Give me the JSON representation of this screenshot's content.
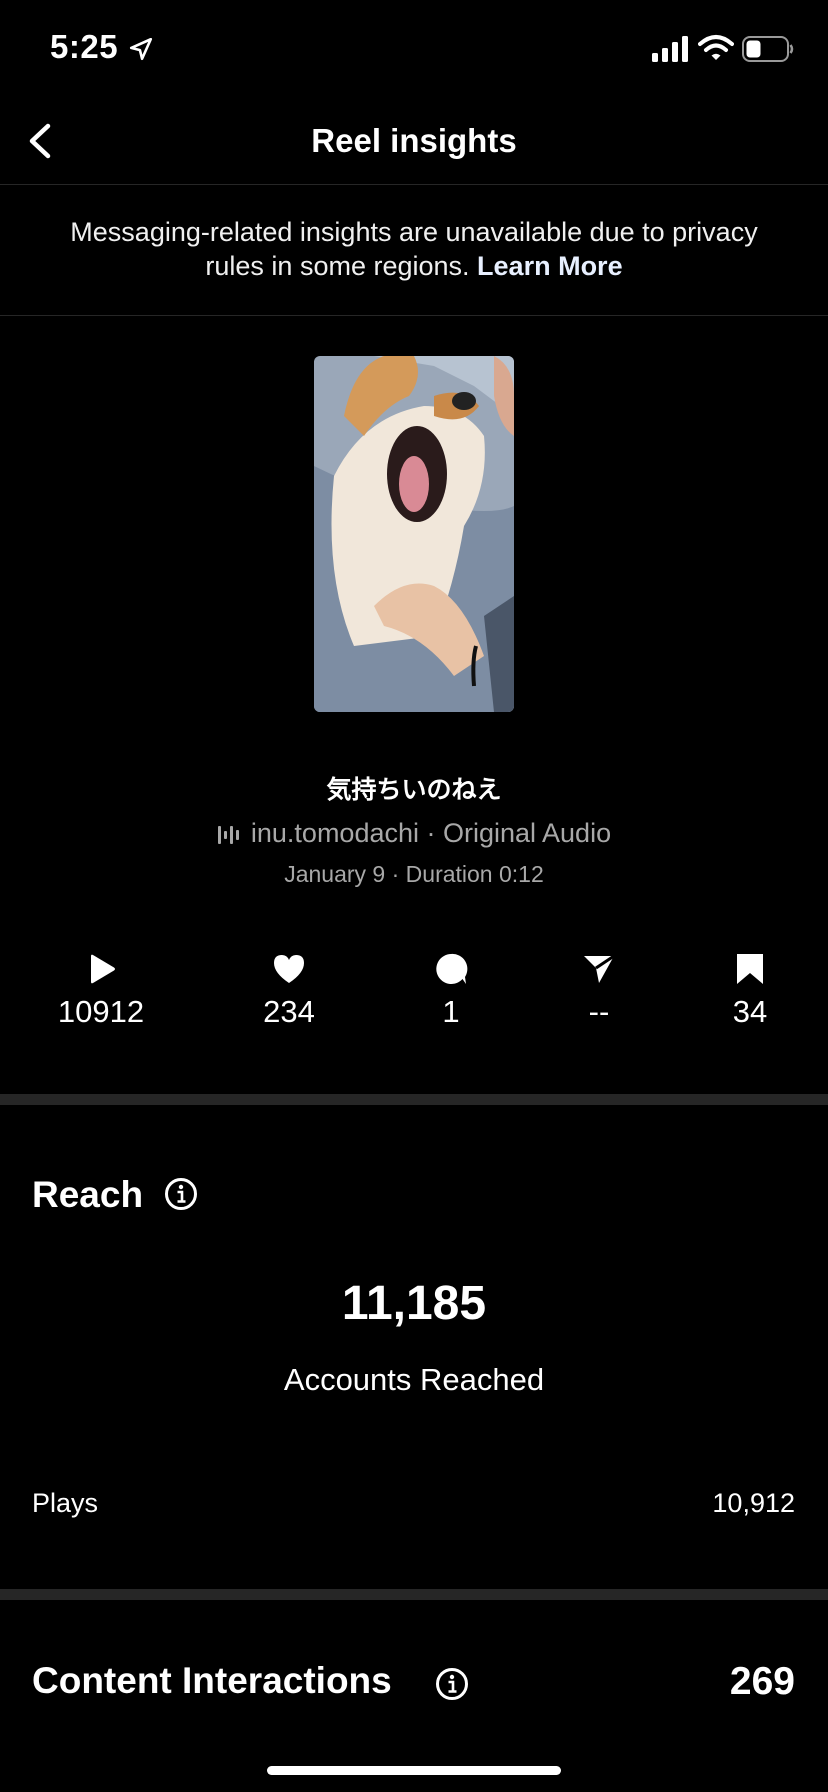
{
  "status_bar": {
    "time": "5:25",
    "icons": [
      "location-arrow-icon",
      "cellular-signal-icon",
      "wifi-icon",
      "battery-icon"
    ]
  },
  "nav": {
    "back_icon": "chevron-left-icon",
    "title": "Reel insights"
  },
  "notice": {
    "text": "Messaging-related insights are unavailable due to privacy rules in some regions.",
    "link": "Learn More"
  },
  "reel": {
    "title": "気持ちいのねえ",
    "audio_icon": "audio-waveform-icon",
    "audio": "inu.tomodachi · Original Audio",
    "meta": "January 9 · Duration 0:12"
  },
  "stats": [
    {
      "icon": "play-icon",
      "value": "10912"
    },
    {
      "icon": "heart-icon",
      "value": "234"
    },
    {
      "icon": "comment-icon",
      "value": "1"
    },
    {
      "icon": "share-icon",
      "value": "--"
    },
    {
      "icon": "bookmark-icon",
      "value": "34"
    }
  ],
  "reach": {
    "title": "Reach",
    "accounts_reached_value": "11,185",
    "accounts_reached_label": "Accounts Reached",
    "plays_label": "Plays",
    "plays_value": "10,912"
  },
  "content_interactions": {
    "title": "Content Interactions",
    "value": "269"
  },
  "colors": {
    "background": "#000000",
    "divider": "#262626",
    "secondary_text": "#a8a8a8"
  }
}
